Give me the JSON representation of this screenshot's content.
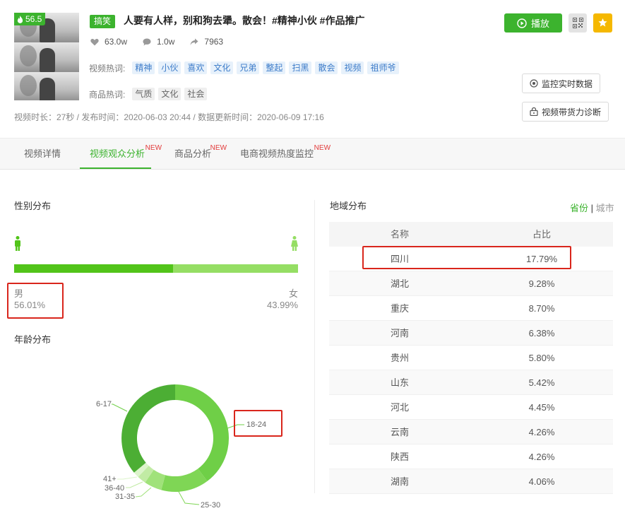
{
  "video": {
    "score": "56.5",
    "genre_tag": "搞笑",
    "title": "人要有人样，别和狗去犟。散会！#精神小伙 #作品推广",
    "likes": "63.0w",
    "comments": "1.0w",
    "shares": "7963",
    "hot_words_label": "视频热词:",
    "hot_words": [
      "精神",
      "小伙",
      "喜欢",
      "文化",
      "兄弟",
      "整起",
      "扫黑",
      "散会",
      "视频",
      "祖师爷"
    ],
    "product_words_label": "商品热词:",
    "product_words": [
      "气质",
      "文化",
      "社会"
    ],
    "meta": "视频时长：27秒 / 发布时间：2020-06-03 20:44 / 数据更新时间：2020-06-09 17:16"
  },
  "actions": {
    "play": "播放",
    "monitor": "监控实时数据",
    "diagnose": "视频带货力诊断"
  },
  "tabs": [
    {
      "label": "视频详情",
      "new": ""
    },
    {
      "label": "视频观众分析",
      "new": "NEW"
    },
    {
      "label": "商品分析",
      "new": "NEW"
    },
    {
      "label": "电商视频热度监控",
      "new": "NEW"
    }
  ],
  "gender": {
    "title": "性别分布",
    "male_label": "男",
    "male_pct": "56.01%",
    "female_label": "女",
    "female_pct": "43.99%",
    "male_value": 56.01,
    "female_value": 43.99,
    "male_color": "#52c41a",
    "female_color": "#95de64"
  },
  "age": {
    "title": "年龄分布",
    "labels": [
      "6-17",
      "18-24",
      "25-30",
      "31-35",
      "36-40",
      "41+"
    ]
  },
  "region": {
    "title": "地域分布",
    "switch_province": "省份",
    "switch_sep": "|",
    "switch_city": "城市",
    "col_name": "名称",
    "col_ratio": "占比",
    "rows": [
      {
        "name": "四川",
        "ratio": "17.79%"
      },
      {
        "name": "湖北",
        "ratio": "9.28%"
      },
      {
        "name": "重庆",
        "ratio": "8.70%"
      },
      {
        "name": "河南",
        "ratio": "6.38%"
      },
      {
        "name": "贵州",
        "ratio": "5.80%"
      },
      {
        "name": "山东",
        "ratio": "5.42%"
      },
      {
        "name": "河北",
        "ratio": "4.45%"
      },
      {
        "name": "云南",
        "ratio": "4.26%"
      },
      {
        "name": "陕西",
        "ratio": "4.26%"
      },
      {
        "name": "湖南",
        "ratio": "4.06%"
      }
    ]
  },
  "colors": {
    "brand": "#3cb32e",
    "highlight": "#d9261c"
  }
}
